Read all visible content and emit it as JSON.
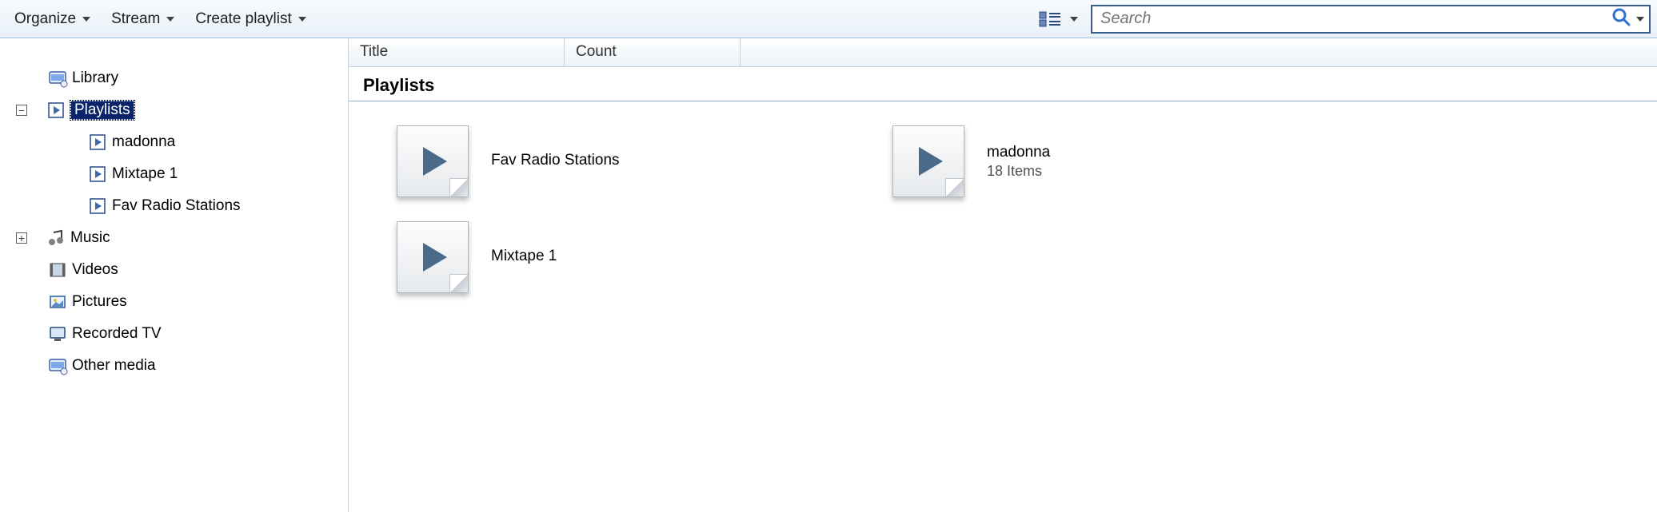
{
  "toolbar": {
    "organize": "Organize",
    "stream": "Stream",
    "create_playlist": "Create playlist"
  },
  "search": {
    "placeholder": "Search"
  },
  "columns": {
    "title": "Title",
    "count": "Count"
  },
  "sidebar": {
    "library": "Library",
    "playlists": "Playlists",
    "playlist_items": [
      "madonna",
      "Mixtape 1",
      "Fav Radio Stations"
    ],
    "music": "Music",
    "videos": "Videos",
    "pictures": "Pictures",
    "recorded_tv": "Recorded TV",
    "other_media": "Other media"
  },
  "content": {
    "group_label": "Playlists",
    "items": [
      {
        "title": "Fav Radio Stations",
        "sub": ""
      },
      {
        "title": "madonna",
        "sub": "18 Items"
      },
      {
        "title": "Mixtape 1",
        "sub": ""
      }
    ]
  }
}
